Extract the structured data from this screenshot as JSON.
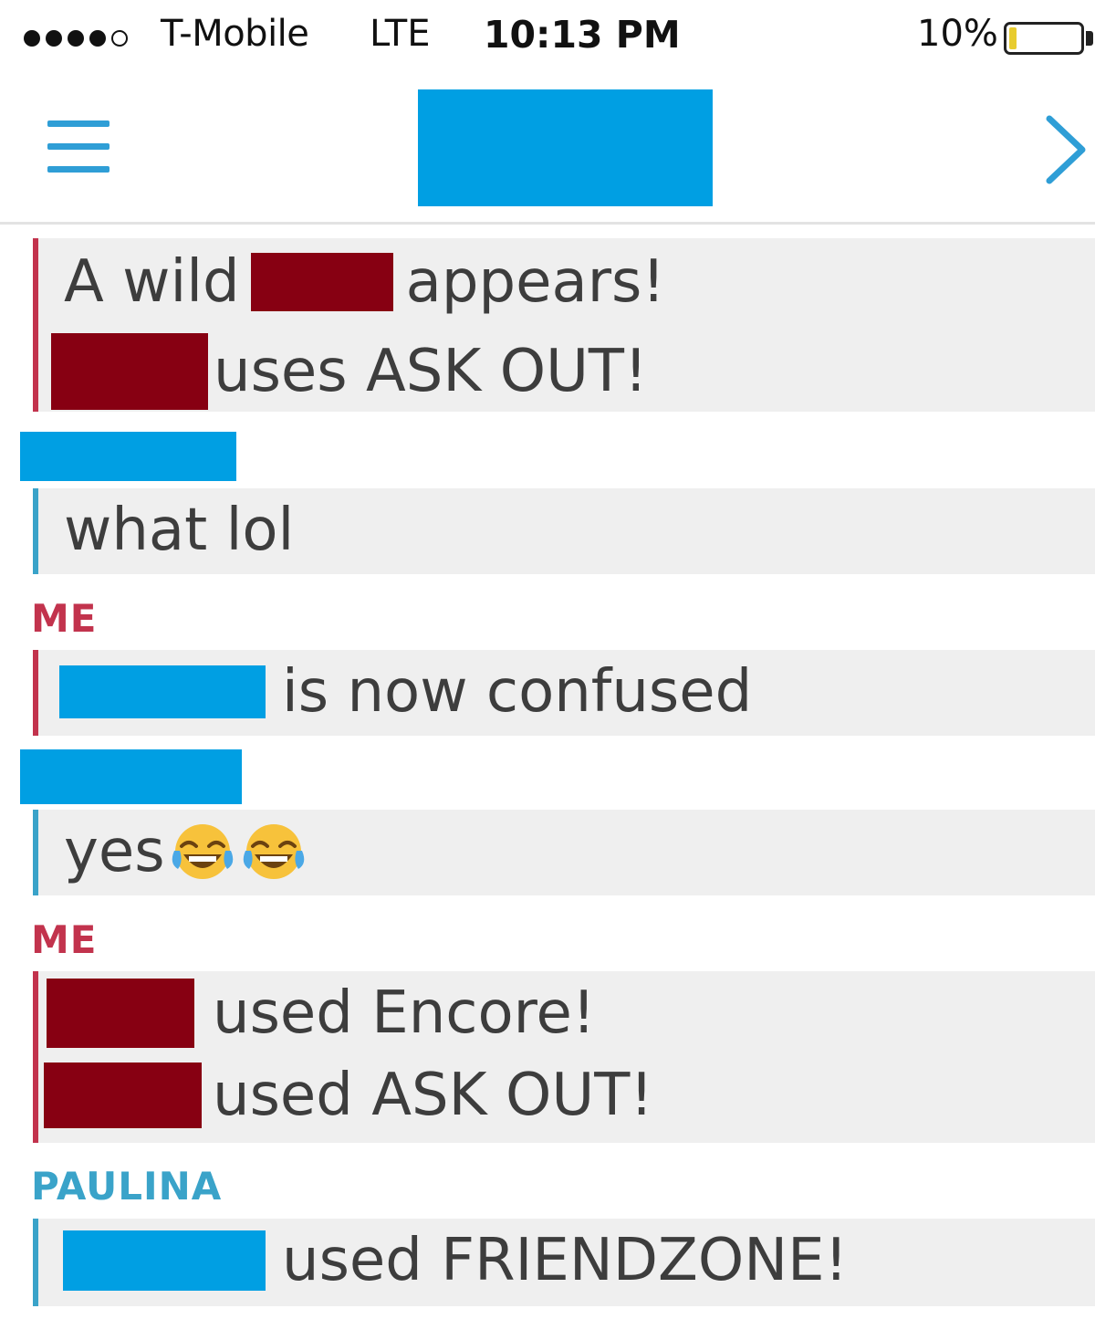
{
  "status_bar": {
    "carrier": "T-Mobile",
    "network": "LTE",
    "time": "10:13 PM",
    "battery_percent": "10%",
    "battery_level": 0.1,
    "signal_bars_filled": 4,
    "signal_bars_total": 5
  },
  "header": {
    "menu_icon": "hamburger-menu-icon",
    "title_redacted": true,
    "next_icon": "chevron-right-icon"
  },
  "colors": {
    "me": "#c2334d",
    "them": "#3aa3c9",
    "redact_red": "#870012",
    "redact_blue": "#009fe3",
    "bubble_bg": "#efefef"
  },
  "messages": [
    {
      "sender": "me",
      "lines": [
        {
          "prefix": "A wild",
          "suffix": "appears!"
        },
        {
          "suffix": "uses ASK OUT!"
        }
      ]
    },
    {
      "sender": "them",
      "lines": [
        {
          "text": "what lol"
        }
      ]
    },
    {
      "sender_label": "ME",
      "lines": [
        {
          "suffix": "is now confused"
        }
      ]
    },
    {
      "sender": "them",
      "lines": [
        {
          "text": "yes",
          "emoji": "tears-of-joy-icon x2"
        }
      ]
    },
    {
      "sender_label": "ME",
      "lines": [
        {
          "suffix": "used Encore!"
        },
        {
          "suffix": "used ASK OUT!"
        }
      ]
    },
    {
      "sender_label": "PAULINA",
      "lines": [
        {
          "suffix": "used FRIENDZONE!"
        }
      ]
    }
  ]
}
